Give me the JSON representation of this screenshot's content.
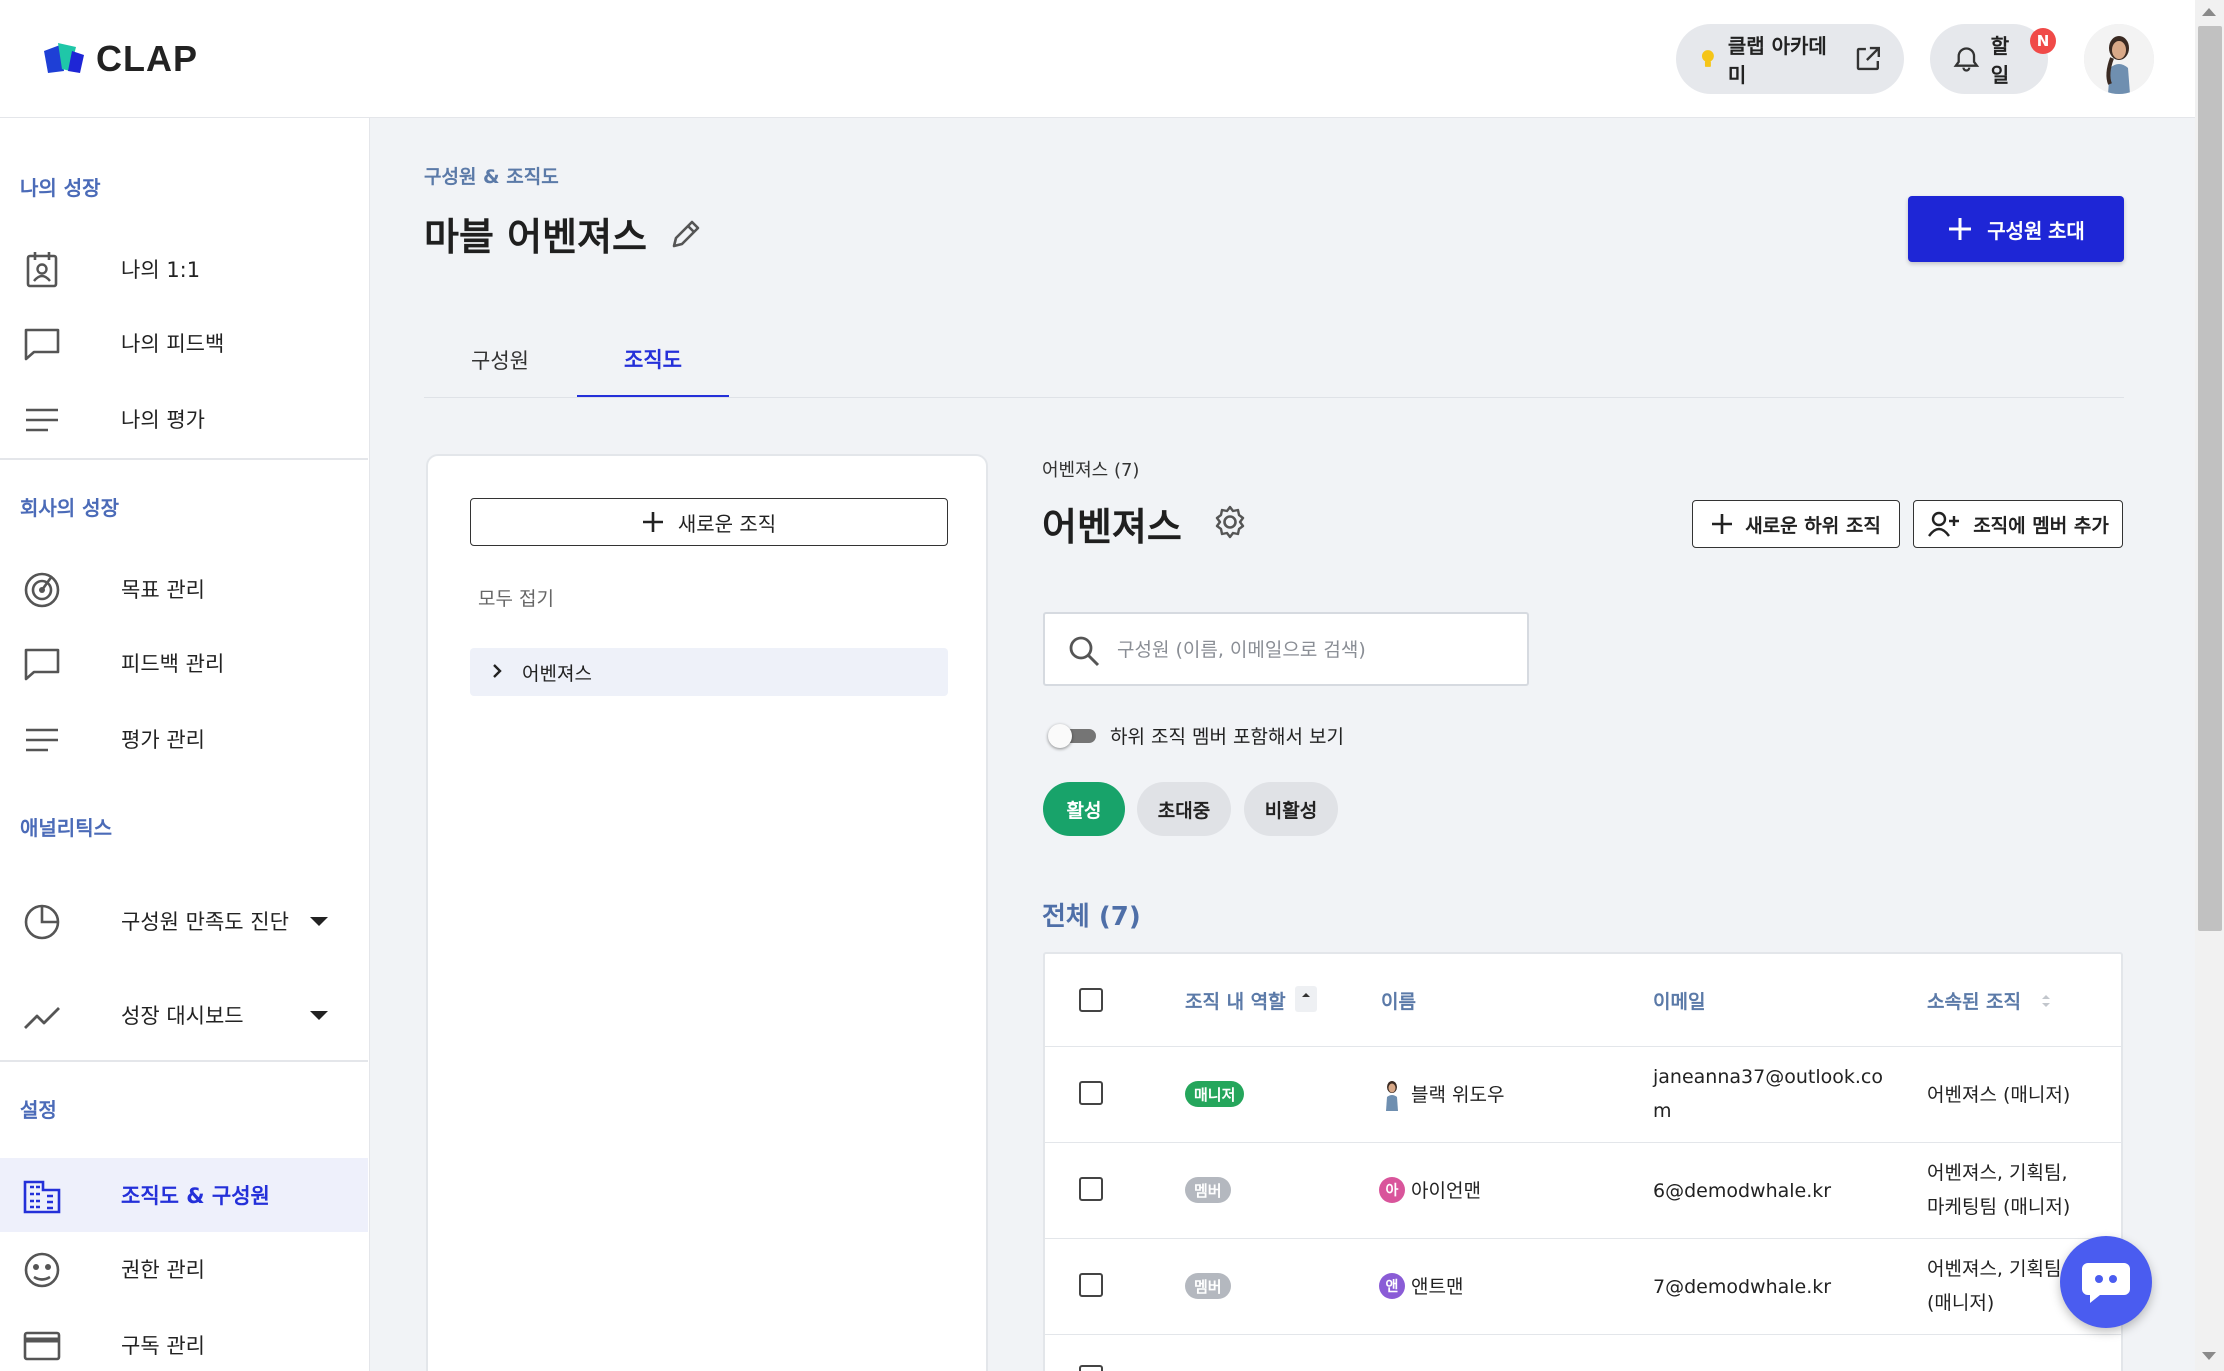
{
  "header": {
    "logo_text": "CLAP",
    "academy_label": "클랩 아카데미",
    "todo_label": "할일",
    "todo_badge": "N"
  },
  "sidebar": {
    "sections": [
      {
        "title": "나의 성장",
        "items": [
          {
            "label": "나의 1:1",
            "icon": "contact-card-icon"
          },
          {
            "label": "나의 피드백",
            "icon": "chat-bubble-icon"
          },
          {
            "label": "나의 평가",
            "icon": "lines-icon"
          }
        ]
      },
      {
        "title": "회사의 성장",
        "items": [
          {
            "label": "목표 관리",
            "icon": "target-icon"
          },
          {
            "label": "피드백 관리",
            "icon": "chat-bubble-icon"
          },
          {
            "label": "평가 관리",
            "icon": "lines-icon"
          }
        ]
      },
      {
        "title": "애널리틱스",
        "items": [
          {
            "label": "구성원 만족도 진단",
            "icon": "pie-icon"
          },
          {
            "label": "성장 대시보드",
            "icon": "trend-icon"
          }
        ]
      },
      {
        "title": "설정",
        "items": [
          {
            "label": "조직도 & 구성원",
            "icon": "building-icon",
            "active": true
          },
          {
            "label": "권한 관리",
            "icon": "face-icon"
          },
          {
            "label": "구독 관리",
            "icon": "card-icon"
          }
        ]
      }
    ]
  },
  "main": {
    "breadcrumb": "구성원 & 조직도",
    "title": "마블 어벤져스",
    "invite_label": "구성원 초대",
    "tabs": [
      {
        "label": "구성원"
      },
      {
        "label": "조직도",
        "active": true
      }
    ]
  },
  "tree": {
    "new_org_label": "새로운 조직",
    "collapse_all_label": "모두 접기",
    "nodes": [
      {
        "label": "어벤져스"
      }
    ]
  },
  "org": {
    "crumb": "어벤져스 (7)",
    "title": "어벤져스",
    "new_sub_label": "새로운 하위 조직",
    "add_member_label": "조직에 멤버 추가",
    "search_placeholder": "구성원 (이름, 이메일으로 검색)",
    "toggle_label": "하위 조직 멤버 포함해서 보기",
    "filters": [
      "활성",
      "초대중",
      "비활성"
    ],
    "total_label": "전체 (7)"
  },
  "table": {
    "columns": [
      "조직 내 역할",
      "이름",
      "이메일",
      "소속된 조직"
    ],
    "rows": [
      {
        "role": "매니저",
        "avatar": "",
        "avatar_color": "#c8a27a",
        "name": "블랙 위도우",
        "email_l1": "janeanna37@outlook.co",
        "email_l2": "m",
        "org_l1": "어벤져스 (매니저)",
        "org_l2": ""
      },
      {
        "role": "멤버",
        "avatar": "아",
        "avatar_color": "#d9559b",
        "name": "아이언맨",
        "email_l1": "6@demodwhale.kr",
        "email_l2": "",
        "org_l1": "어벤져스, 기획팀,",
        "org_l2": "마케팅팀 (매니저)"
      },
      {
        "role": "멤버",
        "avatar": "앤",
        "avatar_color": "#8a5cd6",
        "name": "앤트맨",
        "email_l1": "7@demodwhale.kr",
        "email_l2": "",
        "org_l1": "어벤져스, 기획팀",
        "org_l2": "(매니저)"
      }
    ]
  },
  "colors": {
    "primary": "#1e26d6",
    "active_chip": "#18a36a",
    "manager_badge": "#25a65c",
    "member_badge": "#b4b8bf",
    "section_title": "#4b6bb8",
    "chat_fab": "#4a5cf0"
  }
}
